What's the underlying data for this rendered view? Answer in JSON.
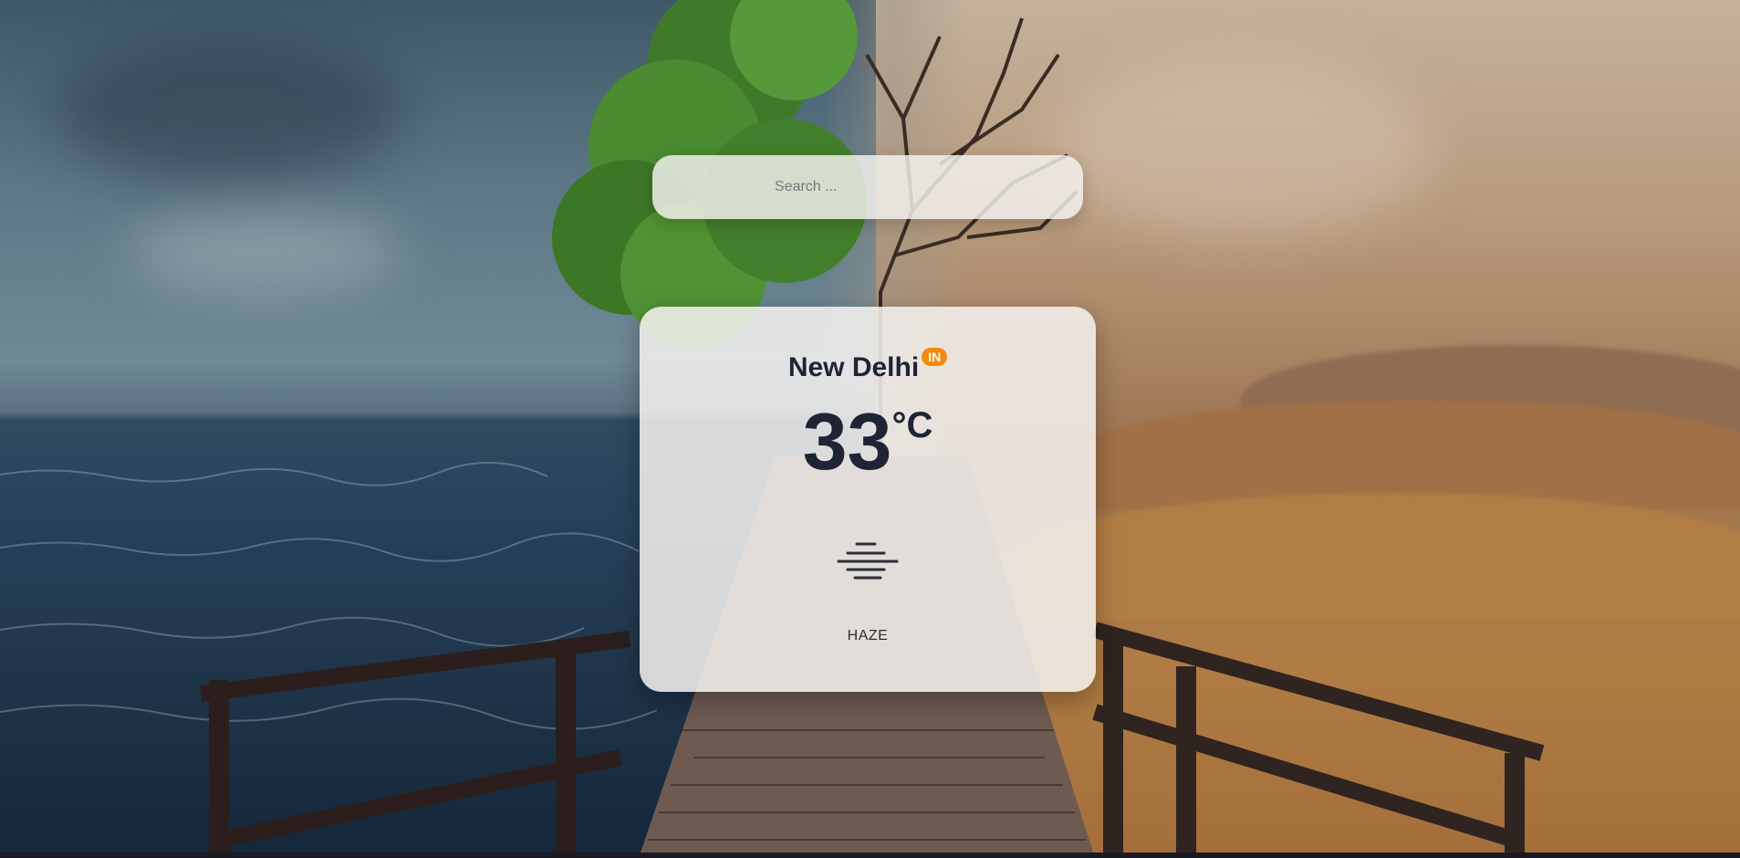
{
  "search": {
    "placeholder": "Search ...",
    "value": ""
  },
  "weather": {
    "city": "New Delhi",
    "country_code": "IN",
    "temperature": "33",
    "unit": "°C",
    "condition": "HAZE",
    "condition_icon": "haze-icon"
  },
  "colors": {
    "badge": "#f28b0c",
    "text_dark": "#1e2434",
    "card_bg": "#f4f2f0"
  }
}
